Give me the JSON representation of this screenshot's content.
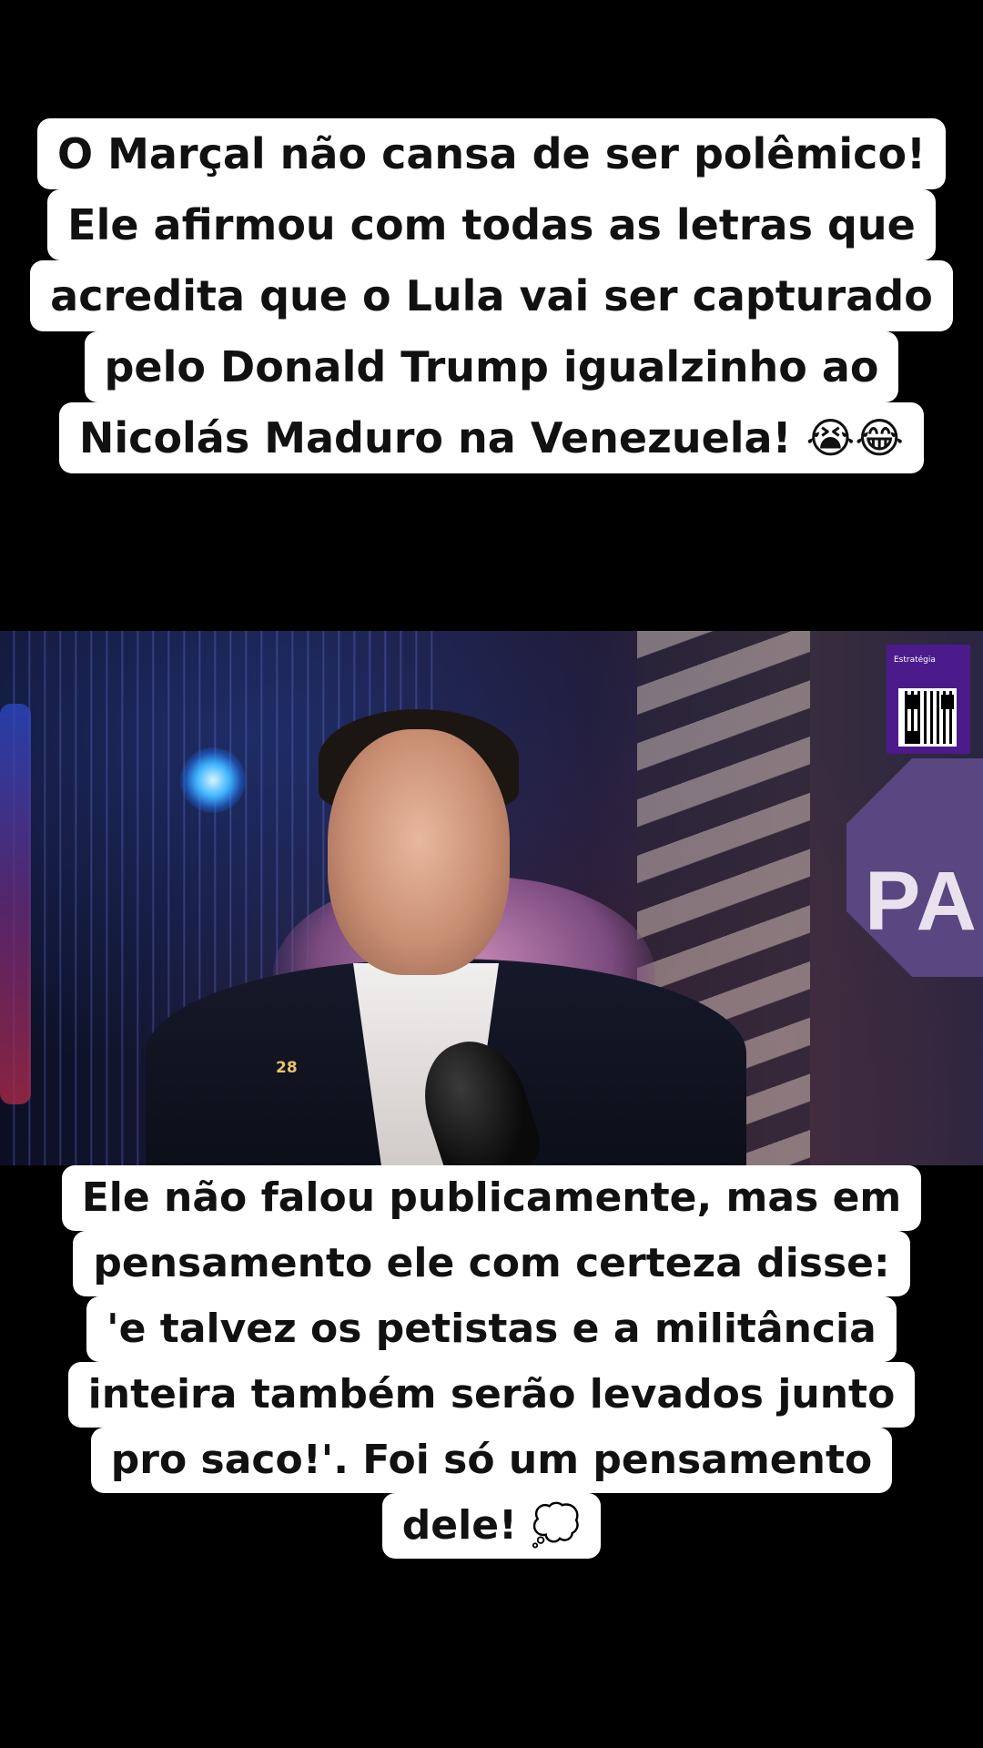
{
  "caption_top": {
    "lines": [
      "O Marçal não cansa de ser polêmico!",
      "Ele afirmou com todas as letras que",
      "acredita que o Lula vai ser capturado",
      "pelo Donald Trump igualzinho ao",
      "Nicolás Maduro na Venezuela! 😭😂"
    ]
  },
  "video": {
    "logo_text": "Estratégia",
    "pin_text": "28",
    "sign_text": "PAR"
  },
  "caption_bottom": {
    "lines": [
      "Ele não falou publicamente, mas em",
      "pensamento ele com certeza disse:",
      "'e talvez os petistas e a militância",
      "inteira também serão levados junto",
      "pro saco!'. Foi só um pensamento",
      "dele! 💭"
    ]
  },
  "colors": {
    "background": "#000000",
    "caption_bg": "#ffffff",
    "caption_text": "#111111",
    "logo_bg": "#4b1b8c"
  }
}
